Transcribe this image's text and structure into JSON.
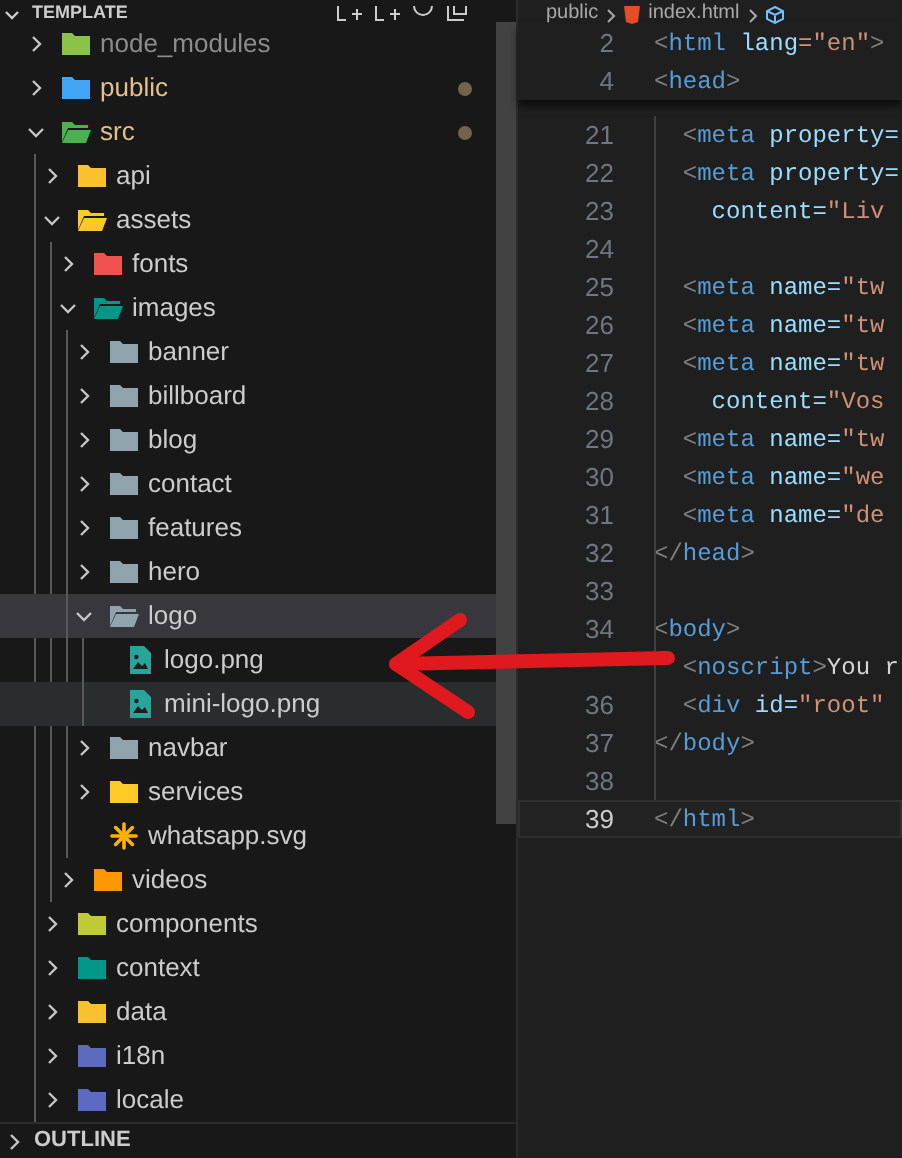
{
  "explorer": {
    "title": "TEMPLATE",
    "tree": [
      {
        "name": "node_modules",
        "kind": "folder",
        "color": "#8bc34a",
        "expanded": false,
        "selected": false,
        "hovered": false,
        "modified": false,
        "ignored": true
      },
      {
        "name": "public",
        "kind": "folder",
        "color": "#42a5f5",
        "expanded": false,
        "selected": false,
        "hovered": false,
        "modified": true,
        "ignored": false
      },
      {
        "name": "src",
        "kind": "folder",
        "color": "#4caf50",
        "expanded": true,
        "selected": false,
        "hovered": false,
        "modified": true,
        "ignored": false,
        "children": [
          {
            "name": "api",
            "kind": "folder",
            "color": "#fbc02d",
            "expanded": false,
            "selected": false,
            "hovered": false,
            "modified": false,
            "ignored": false
          },
          {
            "name": "assets",
            "kind": "folder",
            "color": "#ffca28",
            "expanded": true,
            "selected": false,
            "hovered": false,
            "modified": false,
            "ignored": false,
            "children": [
              {
                "name": "fonts",
                "kind": "folder",
                "color": "#ef5350",
                "expanded": false,
                "selected": false,
                "hovered": false,
                "modified": false,
                "ignored": false
              },
              {
                "name": "images",
                "kind": "folder",
                "color": "#009688",
                "expanded": true,
                "selected": false,
                "hovered": false,
                "modified": false,
                "ignored": false,
                "children": [
                  {
                    "name": "banner",
                    "kind": "folder",
                    "color": "#90a4ae",
                    "expanded": false,
                    "selected": false,
                    "hovered": false,
                    "modified": false,
                    "ignored": false
                  },
                  {
                    "name": "billboard",
                    "kind": "folder",
                    "color": "#90a4ae",
                    "expanded": false,
                    "selected": false,
                    "hovered": false,
                    "modified": false,
                    "ignored": false
                  },
                  {
                    "name": "blog",
                    "kind": "folder",
                    "color": "#90a4ae",
                    "expanded": false,
                    "selected": false,
                    "hovered": false,
                    "modified": false,
                    "ignored": false
                  },
                  {
                    "name": "contact",
                    "kind": "folder",
                    "color": "#90a4ae",
                    "expanded": false,
                    "selected": false,
                    "hovered": false,
                    "modified": false,
                    "ignored": false
                  },
                  {
                    "name": "features",
                    "kind": "folder",
                    "color": "#90a4ae",
                    "expanded": false,
                    "selected": false,
                    "hovered": false,
                    "modified": false,
                    "ignored": false
                  },
                  {
                    "name": "hero",
                    "kind": "folder",
                    "color": "#90a4ae",
                    "expanded": false,
                    "selected": false,
                    "hovered": false,
                    "modified": false,
                    "ignored": false
                  },
                  {
                    "name": "logo",
                    "kind": "folder",
                    "color": "#90a4ae",
                    "expanded": true,
                    "selected": true,
                    "hovered": false,
                    "modified": false,
                    "ignored": false,
                    "children": [
                      {
                        "name": "logo.png",
                        "kind": "image",
                        "color": "#26a69a",
                        "selected": false,
                        "hovered": false,
                        "modified": false,
                        "ignored": false
                      },
                      {
                        "name": "mini-logo.png",
                        "kind": "image",
                        "color": "#26a69a",
                        "selected": false,
                        "hovered": true,
                        "modified": false,
                        "ignored": false
                      }
                    ]
                  },
                  {
                    "name": "navbar",
                    "kind": "folder",
                    "color": "#90a4ae",
                    "expanded": false,
                    "selected": false,
                    "hovered": false,
                    "modified": false,
                    "ignored": false
                  },
                  {
                    "name": "services",
                    "kind": "folder",
                    "color": "#ffca28",
                    "expanded": false,
                    "selected": false,
                    "hovered": false,
                    "modified": false,
                    "ignored": false
                  },
                  {
                    "name": "whatsapp.svg",
                    "kind": "svg",
                    "color": "#ffb300",
                    "selected": false,
                    "hovered": false,
                    "modified": false,
                    "ignored": false
                  }
                ]
              },
              {
                "name": "videos",
                "kind": "folder",
                "color": "#ff9800",
                "expanded": false,
                "selected": false,
                "hovered": false,
                "modified": false,
                "ignored": false
              }
            ]
          },
          {
            "name": "components",
            "kind": "folder",
            "color": "#c0ca33",
            "expanded": false,
            "selected": false,
            "hovered": false,
            "modified": false,
            "ignored": false
          },
          {
            "name": "context",
            "kind": "folder",
            "color": "#009688",
            "expanded": false,
            "selected": false,
            "hovered": false,
            "modified": false,
            "ignored": false
          },
          {
            "name": "data",
            "kind": "folder",
            "color": "#fbc02d",
            "expanded": false,
            "selected": false,
            "hovered": false,
            "modified": false,
            "ignored": false
          },
          {
            "name": "i18n",
            "kind": "folder",
            "color": "#5c6bc0",
            "expanded": false,
            "selected": false,
            "hovered": false,
            "modified": false,
            "ignored": false
          },
          {
            "name": "locale",
            "kind": "folder",
            "color": "#5c6bc0",
            "expanded": false,
            "selected": false,
            "hovered": false,
            "modified": false,
            "ignored": false
          }
        ]
      }
    ],
    "outline": {
      "title": "OUTLINE",
      "expanded": false
    }
  },
  "editor": {
    "breadcrumbs": [
      "public",
      "index.html"
    ],
    "sticky_lines": [
      {
        "number": "2",
        "current": false,
        "tokens": [
          {
            "s": "<",
            "color": "#808080"
          },
          {
            "s": "html",
            "color": "#569cd6"
          },
          {
            "s": " lang",
            "color": "#9cdcfe"
          },
          {
            "s": "=\"en\"",
            "color": "#ce9178"
          },
          {
            "s": ">",
            "color": "#808080"
          }
        ]
      },
      {
        "number": "4",
        "current": false,
        "tokens": [
          {
            "s": "<",
            "color": "#808080"
          },
          {
            "s": "head",
            "color": "#569cd6"
          },
          {
            "s": ">",
            "color": "#808080"
          }
        ]
      }
    ],
    "lines": [
      {
        "number": "21",
        "current": false,
        "tokens": [
          {
            "s": "  <",
            "color": "#808080"
          },
          {
            "s": "meta",
            "color": "#569cd6"
          },
          {
            "s": " property=",
            "color": "#9cdcfe"
          }
        ]
      },
      {
        "number": "22",
        "current": false,
        "tokens": [
          {
            "s": "  <",
            "color": "#808080"
          },
          {
            "s": "meta",
            "color": "#569cd6"
          },
          {
            "s": " property=",
            "color": "#9cdcfe"
          }
        ]
      },
      {
        "number": "23",
        "current": false,
        "tokens": [
          {
            "s": "    content=",
            "color": "#9cdcfe"
          },
          {
            "s": "\"Liv",
            "color": "#ce9178"
          }
        ]
      },
      {
        "number": "24",
        "current": false
      },
      {
        "number": "25",
        "current": false,
        "tokens": [
          {
            "s": "  <",
            "color": "#808080"
          },
          {
            "s": "meta",
            "color": "#569cd6"
          },
          {
            "s": " name=",
            "color": "#9cdcfe"
          },
          {
            "s": "\"tw",
            "color": "#ce9178"
          }
        ]
      },
      {
        "number": "26",
        "current": false,
        "tokens": [
          {
            "s": "  <",
            "color": "#808080"
          },
          {
            "s": "meta",
            "color": "#569cd6"
          },
          {
            "s": " name=",
            "color": "#9cdcfe"
          },
          {
            "s": "\"tw",
            "color": "#ce9178"
          }
        ]
      },
      {
        "number": "27",
        "current": false,
        "tokens": [
          {
            "s": "  <",
            "color": "#808080"
          },
          {
            "s": "meta",
            "color": "#569cd6"
          },
          {
            "s": " name=",
            "color": "#9cdcfe"
          },
          {
            "s": "\"tw",
            "color": "#ce9178"
          }
        ]
      },
      {
        "number": "28",
        "current": false,
        "tokens": [
          {
            "s": "    content=",
            "color": "#9cdcfe"
          },
          {
            "s": "\"Vos",
            "color": "#ce9178"
          }
        ]
      },
      {
        "number": "29",
        "current": false,
        "tokens": [
          {
            "s": "  <",
            "color": "#808080"
          },
          {
            "s": "meta",
            "color": "#569cd6"
          },
          {
            "s": " name=",
            "color": "#9cdcfe"
          },
          {
            "s": "\"tw",
            "color": "#ce9178"
          }
        ]
      },
      {
        "number": "30",
        "current": false,
        "tokens": [
          {
            "s": "  <",
            "color": "#808080"
          },
          {
            "s": "meta",
            "color": "#569cd6"
          },
          {
            "s": " name=",
            "color": "#9cdcfe"
          },
          {
            "s": "\"we",
            "color": "#ce9178"
          }
        ]
      },
      {
        "number": "31",
        "current": false,
        "tokens": [
          {
            "s": "  <",
            "color": "#808080"
          },
          {
            "s": "meta",
            "color": "#569cd6"
          },
          {
            "s": " name=",
            "color": "#9cdcfe"
          },
          {
            "s": "\"de",
            "color": "#ce9178"
          }
        ]
      },
      {
        "number": "32",
        "current": false,
        "tokens": [
          {
            "s": "</",
            "color": "#808080"
          },
          {
            "s": "head",
            "color": "#569cd6"
          },
          {
            "s": ">",
            "color": "#808080"
          }
        ]
      },
      {
        "number": "33",
        "current": false
      },
      {
        "number": "34",
        "current": false,
        "tokens": [
          {
            "s": "<",
            "color": "#808080"
          },
          {
            "s": "body",
            "color": "#569cd6"
          },
          {
            "s": ">",
            "color": "#808080"
          }
        ]
      },
      {
        "current": false,
        "tokens": [
          {
            "s": "  <",
            "color": "#808080"
          },
          {
            "s": "noscript",
            "color": "#569cd6"
          },
          {
            "s": ">",
            "color": "#808080"
          },
          {
            "s": "You r",
            "color": "#d4d4d4"
          }
        ]
      },
      {
        "number": "36",
        "current": false,
        "tokens": [
          {
            "s": "  <",
            "color": "#808080"
          },
          {
            "s": "div",
            "color": "#569cd6"
          },
          {
            "s": " id=",
            "color": "#9cdcfe"
          },
          {
            "s": "\"root\"",
            "color": "#ce9178"
          }
        ]
      },
      {
        "number": "37",
        "current": false,
        "tokens": [
          {
            "s": "</",
            "color": "#808080"
          },
          {
            "s": "body",
            "color": "#569cd6"
          },
          {
            "s": ">",
            "color": "#808080"
          }
        ]
      },
      {
        "number": "38",
        "current": false
      },
      {
        "number": "39",
        "current": true,
        "tokens": [
          {
            "s": "</",
            "color": "#808080"
          },
          {
            "s": "html",
            "color": "#569cd6"
          },
          {
            "s": ">",
            "color": "#808080"
          }
        ]
      }
    ]
  }
}
